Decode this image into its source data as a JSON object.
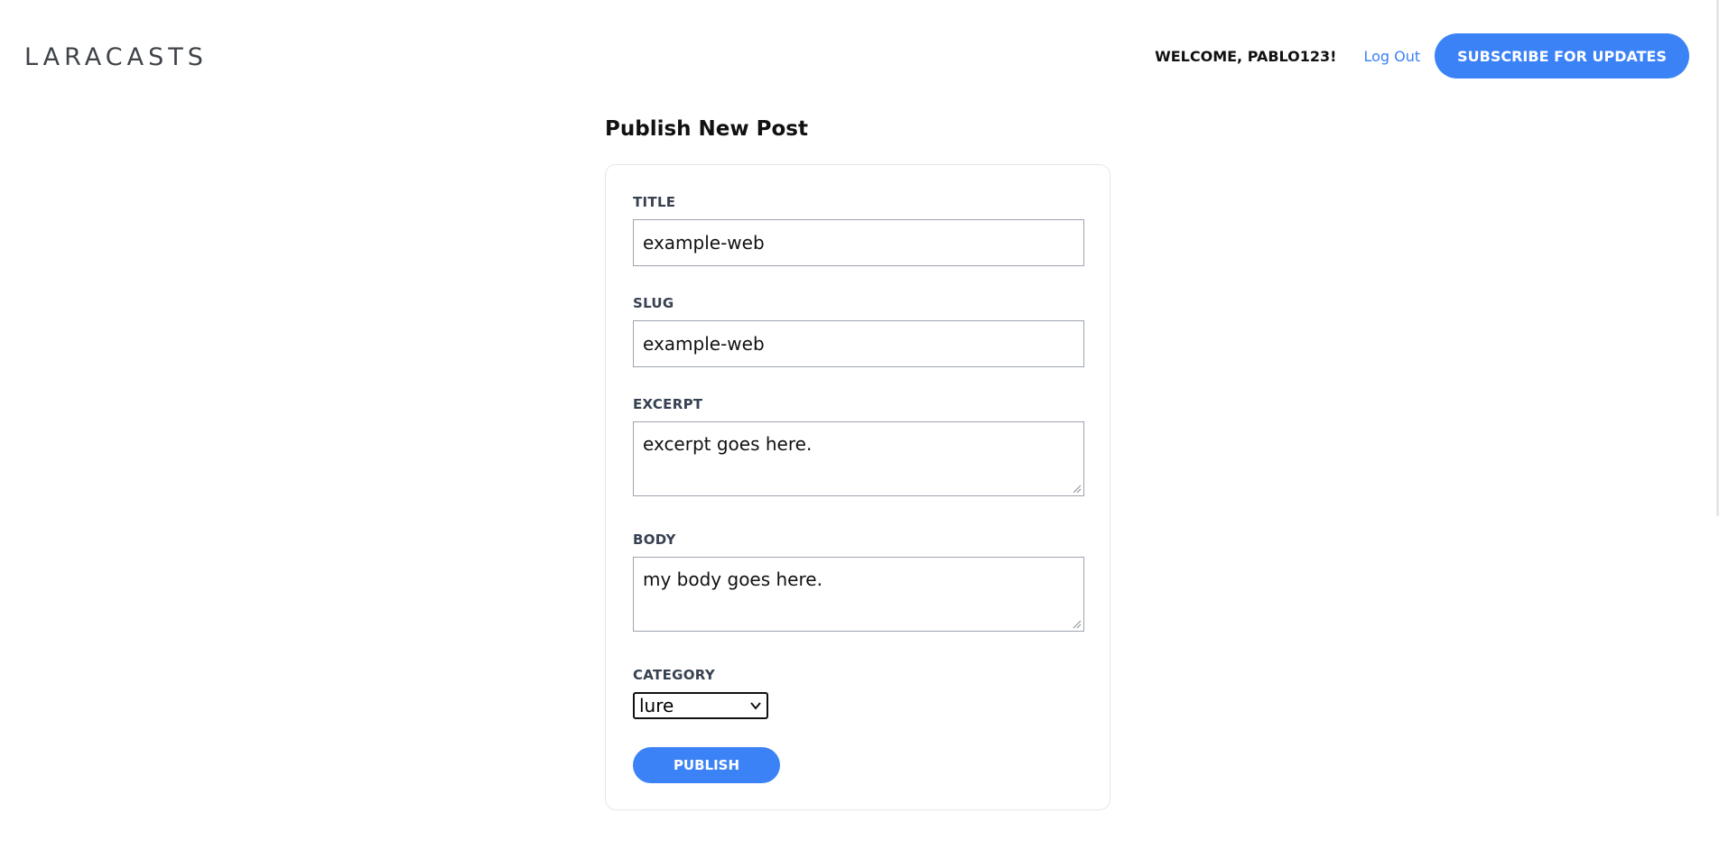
{
  "header": {
    "logo_text": "LARACASTS",
    "welcome": "WELCOME, PABLO123!",
    "logout_label": "Log Out",
    "subscribe_label": "SUBSCRIBE FOR UPDATES"
  },
  "form": {
    "page_title": "Publish New Post",
    "title_label": "TITLE",
    "title_value": "example-web",
    "slug_label": "SLUG",
    "slug_value": "example-web",
    "excerpt_label": "EXCERPT",
    "excerpt_value": "excerpt goes here.",
    "body_label": "BODY",
    "body_value": "my body goes here.",
    "category_label": "CATEGORY",
    "category_value": "lure",
    "publish_label": "PUBLISH"
  },
  "colors": {
    "accent": "#3b82f6",
    "logo": "#3f4348"
  },
  "icons": {
    "logo_mark": "paper-plane-icon",
    "select_arrow": "chevron-down-icon"
  }
}
